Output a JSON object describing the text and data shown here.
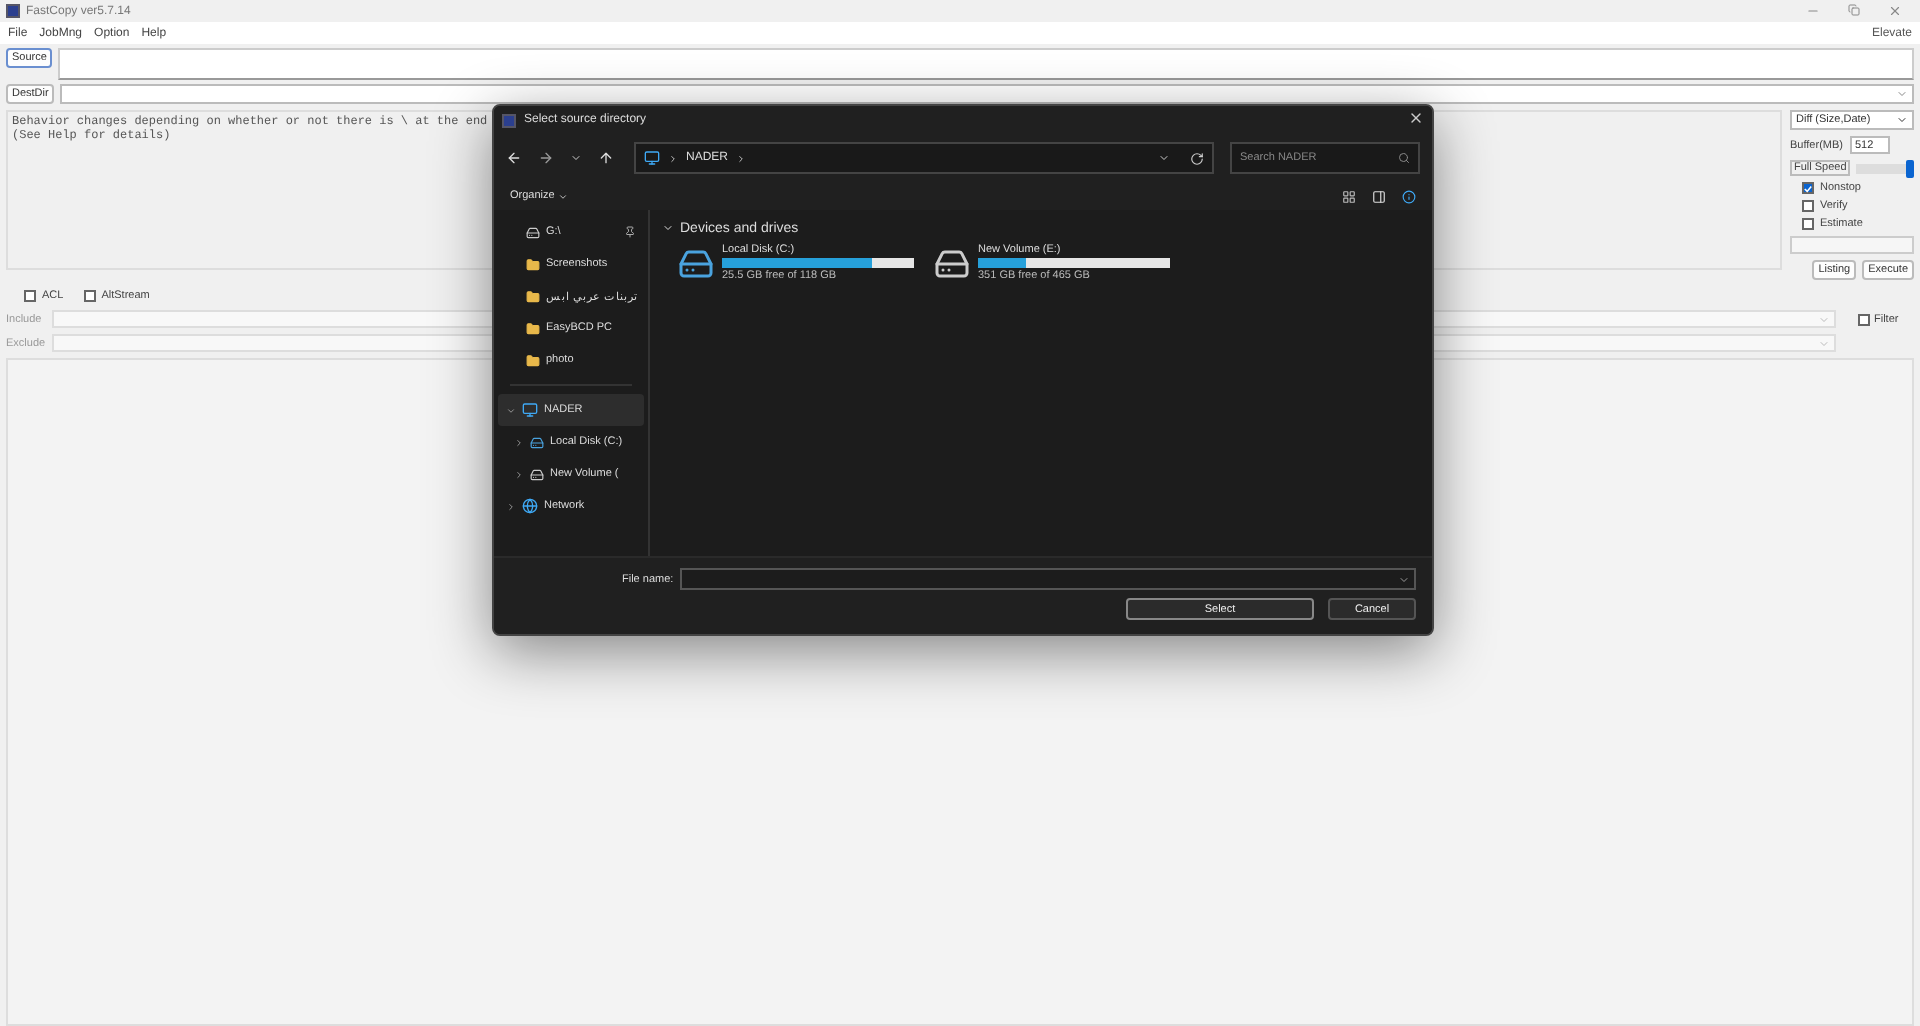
{
  "window": {
    "title": "FastCopy ver5.7.14"
  },
  "menu": [
    {
      "label": "File"
    },
    {
      "label": "JobMng"
    },
    {
      "label": "Option"
    },
    {
      "label": "Help"
    }
  ],
  "elevate": "Elevate",
  "source": {
    "button": "Source"
  },
  "destdir": {
    "button": "DestDir"
  },
  "log": {
    "lines": [
      "Behavior changes depending on whether or not there is \\ at the end",
      "(See Help for details)"
    ]
  },
  "options": {
    "mode": "Diff (Size,Date)",
    "buffer_label": "Buffer(MB)",
    "buffer": "512",
    "speed_label": "Full Speed",
    "level": 1,
    "checks": [
      {
        "label": "Nonstop",
        "checked": true
      },
      {
        "label": "Verify",
        "checked": false
      },
      {
        "label": "Estimate",
        "checked": false
      }
    ],
    "buttons": [
      "Listing",
      "Execute"
    ]
  },
  "flags": [
    {
      "label": "ACL",
      "checked": false
    },
    {
      "label": "AltStream",
      "checked": false
    }
  ],
  "include": {
    "label": "Include"
  },
  "exclude": {
    "label": "Exclude"
  },
  "filter": {
    "label": "Filter",
    "checked": false
  },
  "dialog": {
    "title": "Select source directory",
    "address": {
      "crumbs": [
        "NADER"
      ]
    },
    "search": {
      "placeholder": "Search NADER"
    },
    "organize": "Organize",
    "quick_access": [
      {
        "label": "G:\\",
        "kind": "drive",
        "pinned": true
      },
      {
        "label": "Screenshots",
        "kind": "folder",
        "pinned": false
      },
      {
        "label": "تربنات عربي ابس",
        "kind": "folder",
        "pinned": false
      },
      {
        "label": "EasyBCD PC",
        "kind": "folder",
        "pinned": false
      },
      {
        "label": "photo",
        "kind": "folder",
        "pinned": false
      }
    ],
    "tree": [
      {
        "label": "NADER",
        "kind": "computer",
        "expanded": true,
        "selected": true,
        "children": [
          {
            "label": "Local Disk (C:)",
            "kind": "system-drive",
            "expanded": false,
            "selected": false
          },
          {
            "label": "New Volume (",
            "kind": "drive",
            "expanded": false,
            "selected": false
          }
        ]
      },
      {
        "label": "Network",
        "kind": "network",
        "expanded": false,
        "selected": false
      }
    ],
    "section": "Devices and drives",
    "drives": [
      {
        "name": "Local Disk (C:)",
        "kind": "system",
        "level": 0.78,
        "free": "25.5 GB free of 118 GB"
      },
      {
        "name": "New Volume (E:)",
        "kind": "data",
        "level": 0.25,
        "free": "351 GB free of 465 GB"
      }
    ],
    "filename_label": "File name:",
    "buttons": [
      {
        "label": "Select",
        "primary": true
      },
      {
        "label": "Cancel",
        "primary": false
      }
    ]
  }
}
